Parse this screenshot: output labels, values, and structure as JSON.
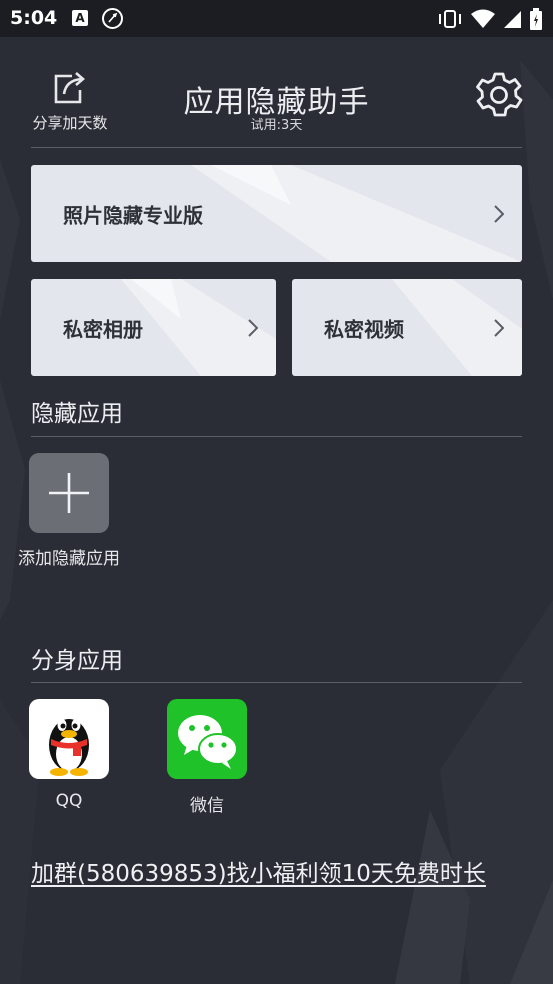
{
  "status_bar": {
    "time": "5:04",
    "a_badge": "A"
  },
  "header": {
    "share_label": "分享加天数",
    "title": "应用隐藏助手",
    "subtitle": "试用:3天"
  },
  "cards": {
    "photo_pro": "照片隐藏专业版",
    "private_album": "私密相册",
    "private_video": "私密视频"
  },
  "hidden_apps": {
    "title": "隐藏应用",
    "add_label": "添加隐藏应用"
  },
  "clone_apps": {
    "title": "分身应用",
    "items": [
      {
        "label": "QQ",
        "icon": "qq-penguin-icon"
      },
      {
        "label": "微信",
        "icon": "wechat-icon"
      }
    ]
  },
  "promo_link": "加群(580639853)找小福利领10天免费时长",
  "colors": {
    "background": "#2a2d35",
    "card": "#e3e6ec",
    "wechat_green": "#20c22a",
    "qq_red": "#e8312a"
  }
}
